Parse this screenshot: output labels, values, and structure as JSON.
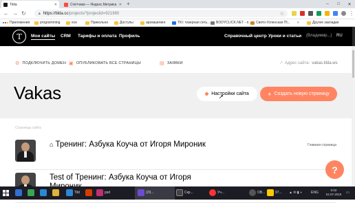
{
  "browser": {
    "tabs": [
      {
        "label": "Tilda",
        "favicon_color": "#1a1a1a"
      },
      {
        "label": "Счётчики — Яндекс.Метрика",
        "favicon_color": "#ff4a3a"
      }
    ],
    "new_tab_symbol": "+",
    "window_controls": [
      "–",
      "□",
      "✕"
    ],
    "url_host": "https://tilda.cc",
    "url_path": "/projects/?projectid=921960",
    "bookmarks": [
      {
        "label": "Приложения",
        "kind": "apps"
      },
      {
        "label": "programming",
        "kind": "folder"
      },
      {
        "label": "ece",
        "kind": "folder"
      },
      {
        "label": "Прикольно",
        "kind": "folder"
      },
      {
        "label": "Доступы",
        "kind": "folder"
      },
      {
        "label": "аромшилинг",
        "kind": "folder"
      },
      {
        "label": "TKI: тизерная сеть...",
        "kind": "site"
      },
      {
        "label": "BODYCLICK.NET - п...",
        "kind": "site"
      },
      {
        "label": "Свято-Успенская Пl...",
        "kind": "site"
      }
    ],
    "bookmarks_more": "»",
    "other_bookmarks": "Другие закладки"
  },
  "tilda_header": {
    "logo_letter": "T",
    "nav": [
      {
        "label": "Мои сайты",
        "active": true
      },
      {
        "label": "CRM",
        "active": false
      },
      {
        "label": "Тарифы и оплата",
        "active": false
      },
      {
        "label": "Профиль",
        "active": false
      }
    ],
    "help_center": "Справочный центр",
    "lessons": "Уроки и статьи",
    "user": "(Владимир...)",
    "lang": "RU"
  },
  "actions": {
    "connect_domain": "ПОДКЛЮЧИТЬ ДОМЕН",
    "publish_all": "ОПУБЛИКОВАТЬ ВСЕ СТРАНИЦЫ",
    "leads": "ЗАЯВКИ",
    "site_address_label": "Адрес сайта:",
    "site_address_value": "vakas.tilda.ws"
  },
  "project": {
    "title": "Vakas",
    "settings_button": "Настройки сайта",
    "create_button": "Создать новую страницу",
    "create_plus": "+"
  },
  "pages": {
    "section_label": "Страницы сайта",
    "items": [
      {
        "title": "Тренинг: Азбука Коуча от Игоря Мироник",
        "is_home": true,
        "badge": "Главная страница"
      },
      {
        "title": "Test of Тренинг: Азбука Коуча от Игоря Мироник",
        "is_home": false,
        "badge": ""
      }
    ],
    "help_fab": "?"
  },
  "taskbar": {
    "items": [
      {
        "label": "",
        "color": "#2f6fd6"
      },
      {
        "label": "",
        "color": "#3aa655"
      },
      {
        "label": "",
        "color": "#2b88d8"
      },
      {
        "label": "",
        "color": "#e0b43a"
      },
      {
        "label": "Tild",
        "color": "#2b88d8"
      },
      {
        "label": "",
        "color": "#d83b01"
      },
      {
        "label": "psd",
        "color": "#c03070"
      },
      {
        "label": "(29...",
        "color": "#6d4bd1"
      },
      {
        "label": "Скр...",
        "color": "#444444"
      },
      {
        "label": "Уч...",
        "color": "#ff3333"
      },
      {
        "label": "ОВ...",
        "color": "#555555"
      },
      {
        "label": "97...",
        "color": "#ffcc00"
      }
    ],
    "tray_lang": "ENG",
    "time": "0:02",
    "date": "04.07.2019"
  }
}
